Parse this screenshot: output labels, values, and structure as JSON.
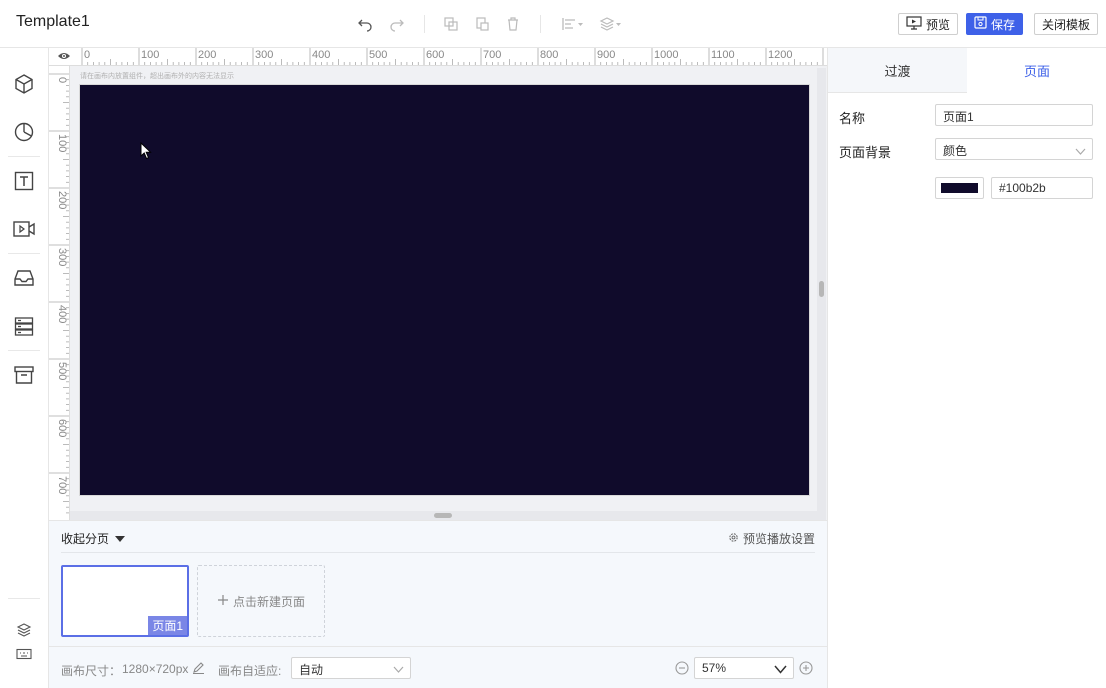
{
  "header": {
    "title": "Template1",
    "tools": [
      {
        "icon": "undo-icon"
      },
      {
        "icon": "redo-icon"
      },
      {
        "icon": "copy-icon"
      },
      {
        "icon": "paste-icon"
      },
      {
        "icon": "delete-icon"
      },
      {
        "icon": "align-icon"
      },
      {
        "icon": "layer-order-icon"
      }
    ],
    "preview_label": "预览",
    "save_label": "保存",
    "close_template_label": "关闭模板"
  },
  "sidebar": {
    "items": [
      {
        "icon": "cube-icon"
      },
      {
        "icon": "chart-icon"
      },
      {
        "icon": "text-icon"
      },
      {
        "icon": "video-icon"
      },
      {
        "icon": "inbox-icon"
      },
      {
        "icon": "server-icon"
      },
      {
        "icon": "archive-icon"
      }
    ],
    "bottom_items": [
      {
        "icon": "layers-icon"
      },
      {
        "icon": "keyboard-icon"
      }
    ]
  },
  "workspace": {
    "ruler_top_labels": [
      "0",
      "100",
      "200",
      "300",
      "400",
      "500",
      "600",
      "700",
      "800",
      "900",
      "1000",
      "1100",
      "1200"
    ],
    "ruler_left_labels": [
      "0",
      "100",
      "200",
      "300",
      "400",
      "500",
      "600",
      "700"
    ],
    "hint": "请在画布内放置组件，超出画布外的内容无法显示",
    "canvas_color": "#100b2b"
  },
  "pages": {
    "collapse_label": "收起分页",
    "play_setting_label": "预览播放设置",
    "page_label": "页面1",
    "new_page_label": "点击新建页面"
  },
  "status": {
    "size_label": "画布尺寸：",
    "size_value": "1280×720px",
    "fit_label": "画布自适应:",
    "fit_value": "自动",
    "zoom_value": "57%"
  },
  "panel": {
    "tabs": [
      "过渡",
      "页面"
    ],
    "active_tab": "页面",
    "name_label": "名称",
    "name_value": "页面1",
    "bg_label": "页面背景",
    "bg_type": "颜色",
    "bg_color_hex": "#100b2b"
  },
  "colors": {
    "accent": "#3e61e8",
    "canvas": "#100b2b"
  }
}
